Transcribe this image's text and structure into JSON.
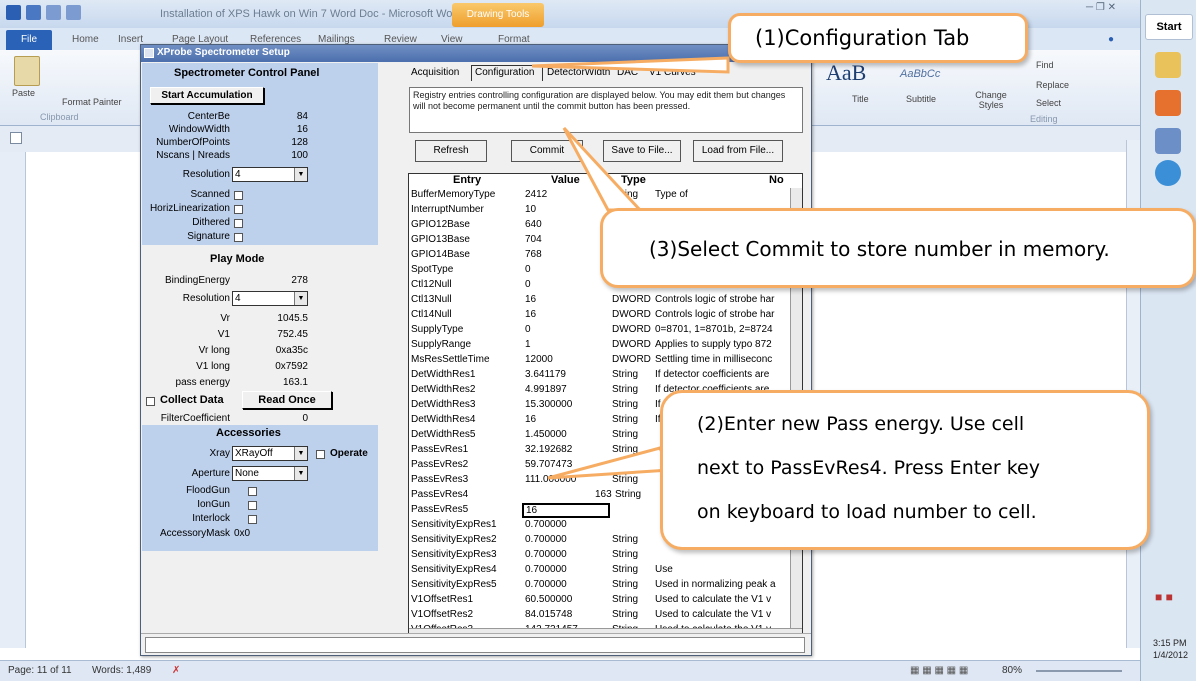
{
  "word": {
    "title": "Installation of XPS Hawk on Win 7 Word Doc - Microsoft Word",
    "contextual_tab": "Drawing Tools",
    "tabs": [
      "File",
      "Home",
      "Insert",
      "Page Layout",
      "References",
      "Mailings",
      "Review",
      "View",
      "Format"
    ],
    "clipboard": {
      "paste": "Paste",
      "format_painter": "Format Painter",
      "group": "Clipboard"
    },
    "styles": {
      "title_sample": "AaB",
      "subtitle_sample": "AaBbCc",
      "title": "Title",
      "subtitle": "Subtitle",
      "change_styles": "Change Styles"
    },
    "editing": {
      "find": "Find",
      "replace": "Replace",
      "select": "Select",
      "group": "Editing"
    },
    "status": {
      "page": "Page: 11 of 11",
      "words": "Words: 1,489",
      "zoom": "80%"
    }
  },
  "sidebar": {
    "start": "Start",
    "time": "3:15 PM",
    "date": "1/4/2012"
  },
  "xprobe": {
    "title": "XProbe Spectrometer Setup",
    "control_panel": {
      "heading": "Spectrometer Control Panel",
      "start_button": "Start Accumulation",
      "fields": [
        {
          "label": "CenterBe",
          "value": "84"
        },
        {
          "label": "WindowWidth",
          "value": "16"
        },
        {
          "label": "NumberOfPoints",
          "value": "128"
        },
        {
          "label": "Nscans | Nreads",
          "value": "100"
        }
      ],
      "resolution_label": "Resolution",
      "resolution_value": "4",
      "checks": [
        "Scanned",
        "HorizLinearization",
        "Dithered",
        "Signature"
      ]
    },
    "play_mode": {
      "heading": "Play Mode",
      "binding_label": "BindingEnergy",
      "binding_value": "278",
      "resolution_label": "Resolution",
      "resolution_value": "4",
      "readouts": [
        {
          "label": "Vr",
          "value": "1045.5"
        },
        {
          "label": "V1",
          "value": "752.45"
        },
        {
          "label": "Vr long",
          "value": "0xa35c"
        },
        {
          "label": "V1 long",
          "value": "0x7592"
        },
        {
          "label": "pass energy",
          "value": "163.1"
        }
      ],
      "collect_label": "Collect Data",
      "read_once": "Read Once",
      "filter_label": "FilterCoefficient",
      "filter_value": "0"
    },
    "accessories": {
      "heading": "Accessories",
      "xray_label": "Xray",
      "xray_value": "XRayOff",
      "operate": "Operate",
      "aperture_label": "Aperture",
      "aperture_value": "None",
      "checks": [
        "FloodGun",
        "IonGun",
        "Interlock"
      ],
      "mask_label": "AccessoryMask",
      "mask_value": "0x0"
    },
    "tabs": [
      "Acquisition",
      "Configuration",
      "DetectorWidth",
      "DAC",
      "V1 Curves"
    ],
    "info": "Registry entries controlling configuration are displayed below. You may edit them but changes will not become permanent until the commit button has been pressed.",
    "buttons": {
      "refresh": "Refresh",
      "commit": "Commit",
      "save": "Save to File...",
      "load": "Load from File..."
    },
    "grid": {
      "headers": [
        "Entry",
        "Value",
        "Type",
        "No"
      ],
      "rows": [
        {
          "entry": "BufferMemoryType",
          "value": "2412",
          "type": "String",
          "note": "Type of"
        },
        {
          "entry": "InterruptNumber",
          "value": "10",
          "type": "",
          "note": ""
        },
        {
          "entry": "GPIO12Base",
          "value": "640",
          "type": "",
          "note": ""
        },
        {
          "entry": "GPIO13Base",
          "value": "704",
          "type": "",
          "note": ""
        },
        {
          "entry": "GPIO14Base",
          "value": "768",
          "type": "",
          "note": ""
        },
        {
          "entry": "SpotType",
          "value": "0",
          "type": "",
          "note": ""
        },
        {
          "entry": "Ctl12Null",
          "value": "0",
          "type": "",
          "note": ""
        },
        {
          "entry": "Ctl13Null",
          "value": "16",
          "type": "DWORD",
          "note": "Controls logic of strobe har"
        },
        {
          "entry": "Ctl14Null",
          "value": "16",
          "type": "DWORD",
          "note": "Controls logic of strobe har"
        },
        {
          "entry": "SupplyType",
          "value": "0",
          "type": "DWORD",
          "note": "0=8701, 1=8701b, 2=8724"
        },
        {
          "entry": "SupplyRange",
          "value": "1",
          "type": "DWORD",
          "note": "Applies to supply typo 872"
        },
        {
          "entry": "MsResSettleTime",
          "value": "12000",
          "type": "DWORD",
          "note": "Settling time in milliseconc"
        },
        {
          "entry": "DetWidthRes1",
          "value": "3.641179",
          "type": "String",
          "note": "If detector coefficients are"
        },
        {
          "entry": "DetWidthRes2",
          "value": "4.991897",
          "type": "String",
          "note": "If detector coefficients are"
        },
        {
          "entry": "DetWidthRes3",
          "value": "15.300000",
          "type": "String",
          "note": "If detector coefficients are"
        },
        {
          "entry": "DetWidthRes4",
          "value": "16",
          "type": "String",
          "note": "If d"
        },
        {
          "entry": "DetWidthRes5",
          "value": "1.450000",
          "type": "String",
          "note": ""
        },
        {
          "entry": "PassEvRes1",
          "value": "32.192682",
          "type": "String",
          "note": ""
        },
        {
          "entry": "PassEvRes2",
          "value": "59.707473",
          "type": "String",
          "note": ""
        },
        {
          "entry": "PassEvRes3",
          "value": "111.000000",
          "type": "String",
          "note": ""
        },
        {
          "entry": "PassEvRes4",
          "value": "163",
          "type": "String",
          "note": ""
        },
        {
          "entry": "PassEvRes5",
          "value": "16",
          "type": "",
          "note": ""
        },
        {
          "entry": "SensitivityExpRes1",
          "value": "0.700000",
          "type": "",
          "note": ""
        },
        {
          "entry": "SensitivityExpRes2",
          "value": "0.700000",
          "type": "String",
          "note": ""
        },
        {
          "entry": "SensitivityExpRes3",
          "value": "0.700000",
          "type": "String",
          "note": ""
        },
        {
          "entry": "SensitivityExpRes4",
          "value": "0.700000",
          "type": "String",
          "note": "Use"
        },
        {
          "entry": "SensitivityExpRes5",
          "value": "0.700000",
          "type": "String",
          "note": "Used in normalizing peak a"
        },
        {
          "entry": "V1OffsetRes1",
          "value": "60.500000",
          "type": "String",
          "note": "Used to calculate the V1 v"
        },
        {
          "entry": "V1OffsetRes2",
          "value": "84.015748",
          "type": "String",
          "note": "Used to calculate the V1 v"
        },
        {
          "entry": "V1OffsetRes3",
          "value": "142.721457",
          "type": "String",
          "note": "Used to calculate the V1 v"
        }
      ]
    }
  },
  "callouts": {
    "config_tab": "(1)Configuration Tab",
    "commit": "(3)Select Commit to store number in memory.",
    "pass_energy_1": "(2)Enter new Pass energy.  Use cell",
    "pass_energy_2": "next to PassEvRes4.   Press Enter key",
    "pass_energy_3": "on keyboard to load number to cell."
  },
  "colors": {
    "callout_border": "#f6ad63",
    "panel_blue": "#bdd0ec",
    "word_file_tab": "#2a62b8"
  }
}
